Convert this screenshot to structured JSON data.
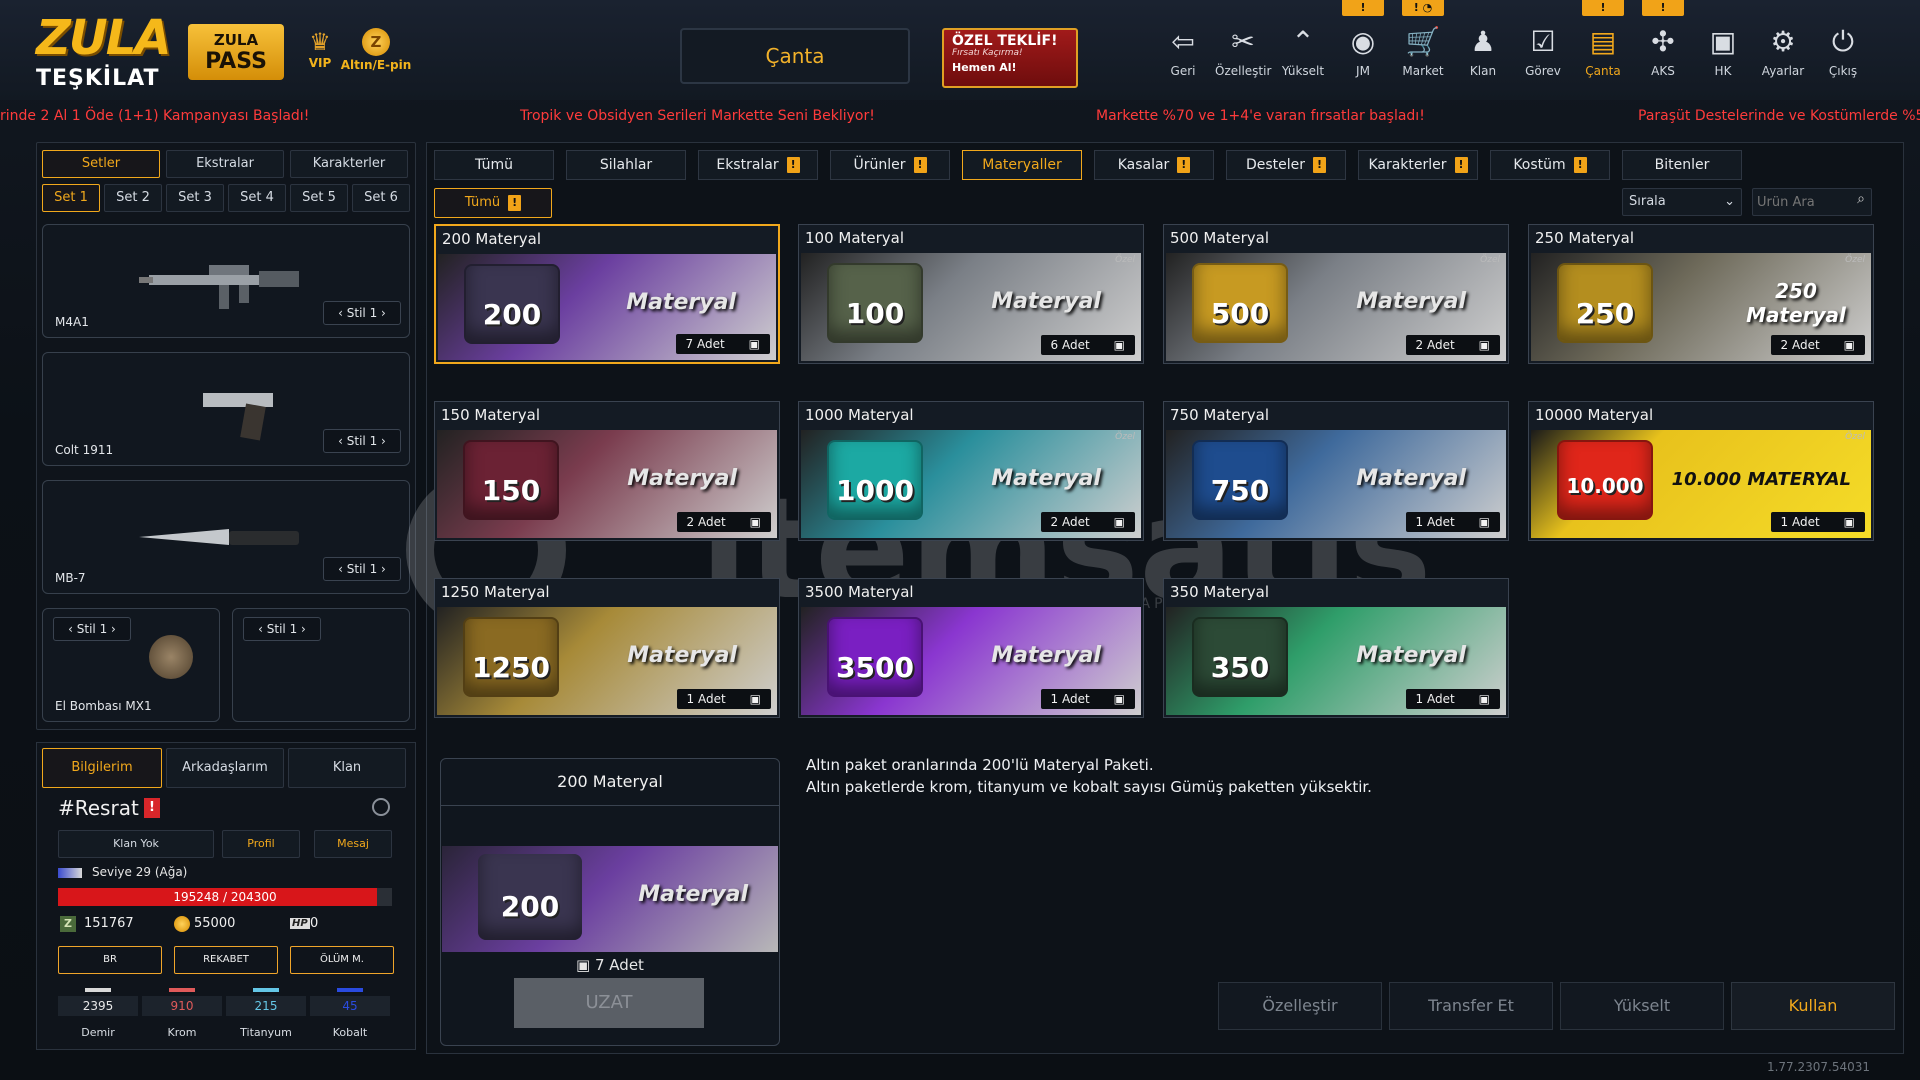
{
  "header": {
    "logo_line1": "ZULA",
    "logo_line2": "TEŞKİLAT",
    "pass_line1": "ZULA",
    "pass_line2": "PASS",
    "vip_label": "VIP",
    "altin_label": "Altın/E-pin",
    "canta_title": "Çanta",
    "offer_title": "ÖZEL TEKLİF!",
    "offer_sub": "Fırsatı Kaçırma!",
    "offer_cta": "Hemen Al!",
    "nav": [
      {
        "label": "Geri",
        "icon": "exit-icon"
      },
      {
        "label": "Özelleştir",
        "icon": "tools-icon"
      },
      {
        "label": "Yükselt",
        "icon": "rank-up-icon"
      },
      {
        "label": "JM",
        "icon": "coins-icon"
      },
      {
        "label": "Market",
        "icon": "cart-icon"
      },
      {
        "label": "Klan",
        "icon": "clan-icon"
      },
      {
        "label": "Görev",
        "icon": "clipboard-icon"
      },
      {
        "label": "Çanta",
        "icon": "bag-icon"
      },
      {
        "label": "AKS",
        "icon": "network-icon"
      },
      {
        "label": "HK",
        "icon": "wallet-icon"
      },
      {
        "label": "Ayarlar",
        "icon": "gear-icon"
      },
      {
        "label": "Çıkış",
        "icon": "power-icon"
      }
    ],
    "badges": [
      "!",
      "! ◔",
      "!",
      "!"
    ]
  },
  "ticker": [
    "rinde 2 Al 1 Öde (1+1) Kampanyası Başladı!",
    "Tropik ve Obsidyen Serileri Markette Seni Bekliyor!",
    "Markette %70 ve 1+4'e varan fırsatlar başladı!",
    "Paraşüt Destelerinde ve Kostümlerde %50 i"
  ],
  "left": {
    "tabs": [
      "Setler",
      "Ekstralar",
      "Karakterler"
    ],
    "sets": [
      "Set 1",
      "Set 2",
      "Set 3",
      "Set 4",
      "Set 5",
      "Set 6"
    ],
    "weapons": [
      {
        "name": "M4A1",
        "style": "Stil 1"
      },
      {
        "name": "Colt 1911",
        "style": "Stil 1"
      },
      {
        "name": "MB-7",
        "style": "Stil 1"
      },
      {
        "name": "El Bombası MX1",
        "style": "Stil 1"
      },
      {
        "name": "",
        "style": "Stil 1"
      }
    ]
  },
  "profile": {
    "tabs": [
      "Bilgilerim",
      "Arkadaşlarım",
      "Klan"
    ],
    "name": "#Resrat",
    "warn": "!",
    "clan": "Klan Yok",
    "profil_btn": "Profil",
    "mesaj_btn": "Mesaj",
    "level": "Seviye 29 (Ağa)",
    "xp_text": "195248 / 204300",
    "xp_fraction": 0.956,
    "z_value": "151767",
    "gold_value": "55000",
    "hp_value": "0",
    "hp_label": "HP",
    "medals": [
      "BR",
      "REKABET",
      "ÖLÜM M."
    ],
    "materials": [
      {
        "label": "Demir",
        "value": "2395",
        "color": "#d9d9d9"
      },
      {
        "label": "Krom",
        "value": "910",
        "color": "#e05a5a"
      },
      {
        "label": "Titanyum",
        "value": "215",
        "color": "#64c6e6"
      },
      {
        "label": "Kobalt",
        "value": "45",
        "color": "#2a4be0"
      }
    ]
  },
  "main": {
    "tabs": [
      {
        "label": "Tümü",
        "warn": false
      },
      {
        "label": "Silahlar",
        "warn": false
      },
      {
        "label": "Ekstralar",
        "warn": true
      },
      {
        "label": "Ürünler",
        "warn": true
      },
      {
        "label": "Materyaller",
        "warn": false
      },
      {
        "label": "Kasalar",
        "warn": true
      },
      {
        "label": "Desteler",
        "warn": true
      },
      {
        "label": "Karakterler",
        "warn": true
      },
      {
        "label": "Kostüm",
        "warn": true
      },
      {
        "label": "Bitenler",
        "warn": false
      }
    ],
    "filter_label": "Tümü",
    "sort_label": "Sırala",
    "search_placeholder": "Ürün Ara",
    "materyal_word": "Materyal",
    "ozel_word": "Özel",
    "items": [
      {
        "title": "200 Materyal",
        "num": "200",
        "count": "7 Adet",
        "color": "#3a3550",
        "bg": "#6b3fa0",
        "special": false
      },
      {
        "title": "100 Materyal",
        "num": "100",
        "count": "6 Adet",
        "color": "#56624a",
        "bg": "#7a7f86",
        "special": true
      },
      {
        "title": "500 Materyal",
        "num": "500",
        "count": "2 Adet",
        "color": "#c79a22",
        "bg": "#7a7f86",
        "special": true
      },
      {
        "title": "250 Materyal",
        "num": "250",
        "count": "2 Adet",
        "color": "#b48e1f",
        "bg": "#6e6a5a",
        "special": true,
        "alt": "250 Materyal"
      },
      {
        "title": "150 Materyal",
        "num": "150",
        "count": "2 Adet",
        "color": "#6b2234",
        "bg": "#7a3c4e",
        "special": false
      },
      {
        "title": "1000 Materyal",
        "num": "1000",
        "count": "2 Adet",
        "color": "#1ca9a3",
        "bg": "#2a8f9c",
        "special": true
      },
      {
        "title": "750 Materyal",
        "num": "750",
        "count": "1 Adet",
        "color": "#1e4c8e",
        "bg": "#3f6a9c",
        "special": false
      },
      {
        "title": "10000 Materyal",
        "num": "10.000",
        "count": "1 Adet",
        "color": "#e0261a",
        "bg": "#e8c21c",
        "special": true,
        "alt": "10.000 MATERYAL"
      },
      {
        "title": "1250 Materyal",
        "num": "1250",
        "count": "1 Adet",
        "color": "#8a6a22",
        "bg": "#a78a38",
        "special": false
      },
      {
        "title": "3500 Materyal",
        "num": "3500",
        "count": "1 Adet",
        "color": "#7a1fc2",
        "bg": "#8a36d0",
        "special": false
      },
      {
        "title": "350 Materyal",
        "num": "350",
        "count": "1 Adet",
        "color": "#2c4a36",
        "bg": "#2f9e6a",
        "special": false
      }
    ],
    "detail": {
      "title": "200 Materyal",
      "num": "200",
      "count": "7 Adet",
      "uzat": "UZAT",
      "desc1": "Altın paket oranlarında 200'lü Materyal Paketi.",
      "desc2": "Altın paketlerde krom, titanyum ve kobalt sayısı Gümüş paketten yüksektir."
    },
    "actions": [
      "Özelleştir",
      "Transfer Et",
      "Yükselt",
      "Kullan"
    ],
    "version": "1.77.2307.54031"
  },
  "watermark": {
    "brand": "itemsatis",
    "tag": "HESAP / SKIN / ITEM / E-PIN",
    "domain": ".com"
  }
}
